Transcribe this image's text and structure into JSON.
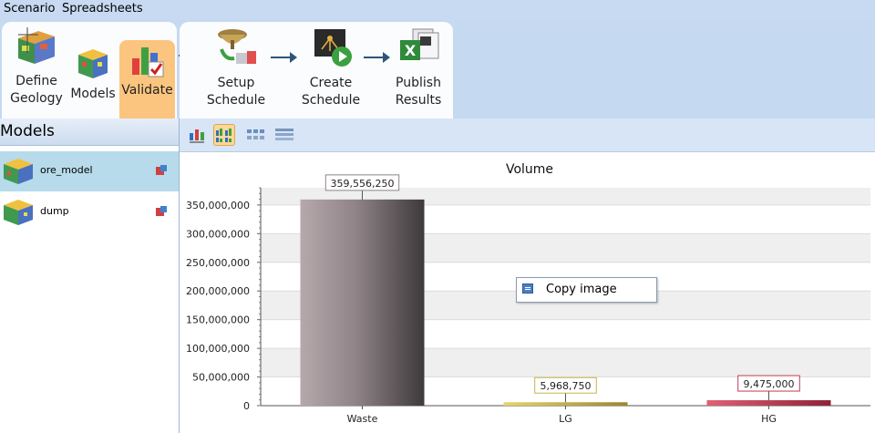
{
  "menu": {
    "scenario": "Scenario",
    "spreadsheets": "Spreadsheets"
  },
  "ribbon": {
    "define_line1": "Define",
    "define_line2": "Geology",
    "models": "Models",
    "validate": "Validate",
    "setup_line1": "Setup",
    "setup_line2": "Schedule",
    "create_line1": "Create",
    "create_line2": "Schedule",
    "publish_line1": "Publish",
    "publish_line2": "Results"
  },
  "sidebar": {
    "title": "Models",
    "items": [
      {
        "label": "ore_model",
        "selected": true
      },
      {
        "label": "dump",
        "selected": false
      }
    ]
  },
  "context_menu": {
    "copy_image": "Copy image"
  },
  "colors": {
    "accent": "#fbc57f",
    "waste": "#8f8387",
    "lg": "#c9b448",
    "hg": "#c23b53"
  },
  "chart_data": {
    "type": "bar",
    "title": "Volume",
    "categories": [
      "Waste",
      "LG",
      "HG"
    ],
    "values": [
      359556250,
      5968750,
      9475000
    ],
    "value_labels": [
      "359,556,250",
      "5,968,750",
      "9,475,000"
    ],
    "ylim": [
      0,
      380000000
    ],
    "yticks": [
      0,
      50000000,
      100000000,
      150000000,
      200000000,
      250000000,
      300000000,
      350000000
    ],
    "ytick_labels": [
      "0",
      "50,000,000",
      "100,000,000",
      "150,000,000",
      "200,000,000",
      "250,000,000",
      "300,000,000",
      "350,000,000"
    ],
    "grid": true,
    "legend": "none"
  }
}
